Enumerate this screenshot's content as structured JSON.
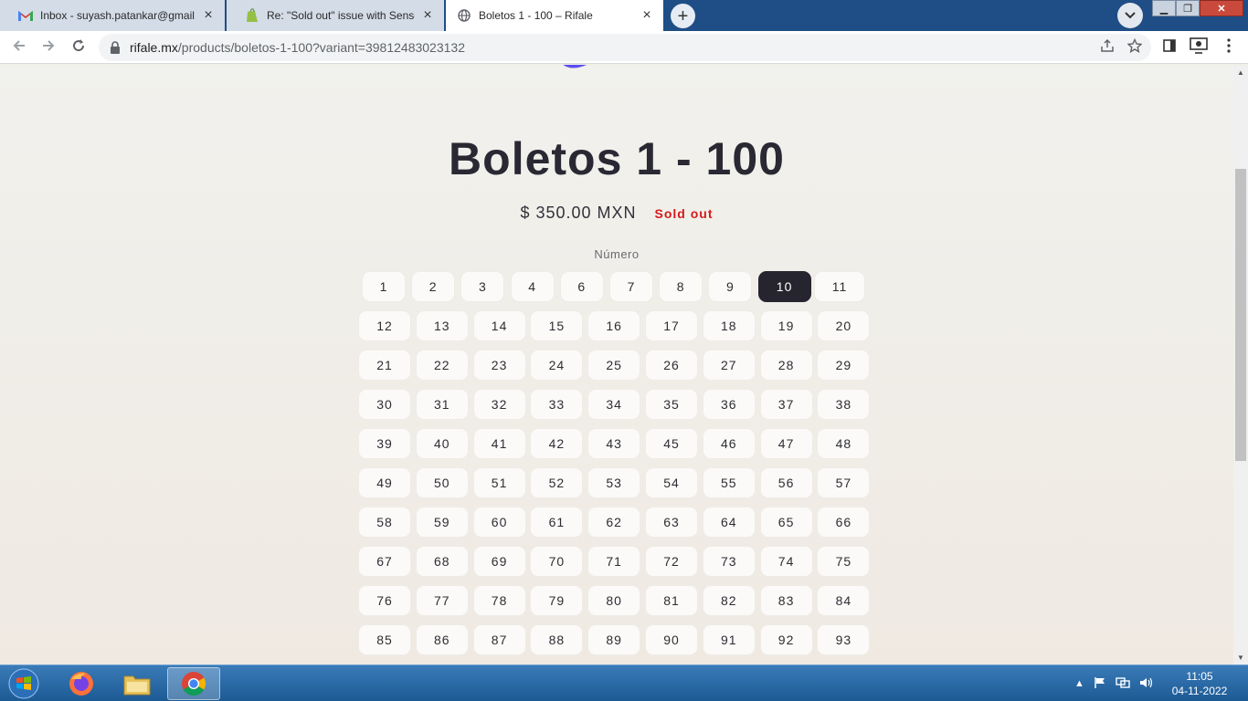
{
  "browser": {
    "tabs": [
      {
        "title": "Inbox - suyash.patankar@gmail.c",
        "icon": "gmail-icon",
        "active": false
      },
      {
        "title": "Re: \"Sold out\" issue with Sense th",
        "icon": "shopify-icon",
        "active": false
      },
      {
        "title": "Boletos 1 - 100 – Rifale",
        "icon": "globe-icon",
        "active": true
      }
    ],
    "new_tab": "+",
    "url_domain": "rifale.mx",
    "url_path": "/products/boletos-1-100?variant=39812483023132"
  },
  "product": {
    "title": "Boletos 1 - 100",
    "price": "$ 350.00 MXN",
    "status": "Sold out",
    "option_label": "Número",
    "selected": "10",
    "rows": [
      [
        "1",
        "2",
        "3",
        "4",
        "6",
        "7",
        "8",
        "9",
        "10",
        "11"
      ],
      [
        "12",
        "13",
        "14",
        "15",
        "16",
        "17",
        "18",
        "19",
        "20"
      ],
      [
        "21",
        "22",
        "23",
        "24",
        "25",
        "26",
        "27",
        "28",
        "29"
      ],
      [
        "30",
        "31",
        "32",
        "33",
        "34",
        "35",
        "36",
        "37",
        "38"
      ],
      [
        "39",
        "40",
        "41",
        "42",
        "43",
        "45",
        "46",
        "47",
        "48"
      ],
      [
        "49",
        "50",
        "51",
        "52",
        "53",
        "54",
        "55",
        "56",
        "57"
      ],
      [
        "58",
        "59",
        "60",
        "61",
        "62",
        "63",
        "64",
        "65",
        "66"
      ],
      [
        "67",
        "68",
        "69",
        "70",
        "71",
        "72",
        "73",
        "74",
        "75"
      ],
      [
        "76",
        "77",
        "78",
        "79",
        "80",
        "81",
        "82",
        "83",
        "84"
      ],
      [
        "85",
        "86",
        "87",
        "88",
        "89",
        "90",
        "91",
        "92",
        "93"
      ]
    ]
  },
  "taskbar": {
    "time": "11:05",
    "date": "04-11-2022",
    "apps": [
      "firefox-icon",
      "file-explorer-icon",
      "chrome-icon"
    ]
  },
  "colors": {
    "accent_dark": "#26242e",
    "sold_out": "#d51a1a",
    "tabstrip": "#1f4e86"
  }
}
